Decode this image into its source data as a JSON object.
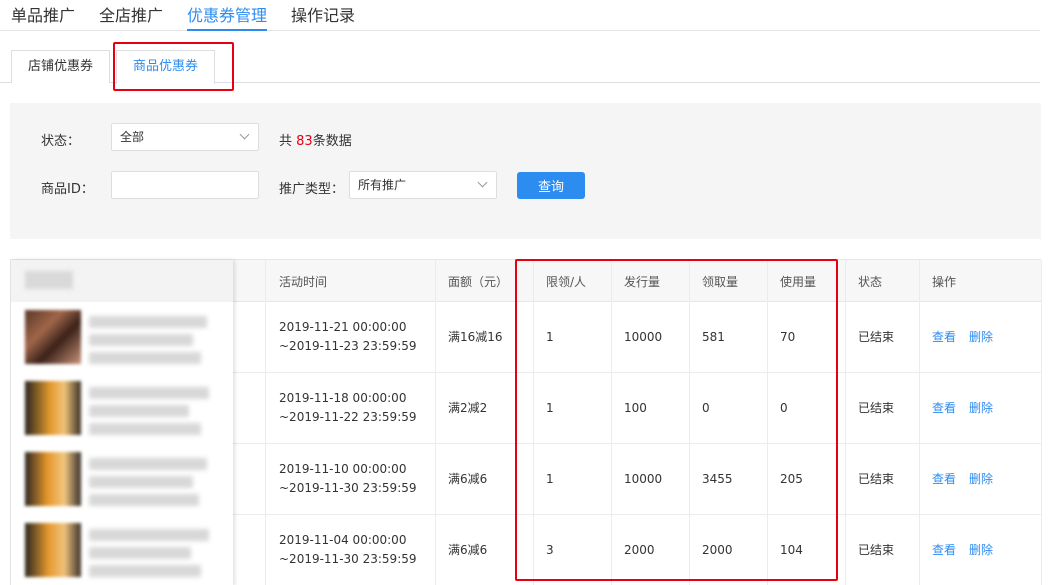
{
  "top_tabs": [
    "单品推广",
    "全店推广",
    "优惠券管理",
    "操作记录"
  ],
  "sub_tabs": [
    "店铺优惠券",
    "商品优惠券"
  ],
  "filter": {
    "status_label": "状态：",
    "status_value": "全部",
    "count_prefix": "共",
    "count_value": "83",
    "count_suffix": "条数据",
    "product_id_label": "商品ID：",
    "product_id_value": "",
    "promo_type_label": "推广类型：",
    "promo_type_value": "所有推广",
    "query_button": "查询"
  },
  "table": {
    "columns": [
      "活动时间",
      "面额（元）",
      "限领/人",
      "发行量",
      "领取量",
      "使用量",
      "状态",
      "操作"
    ],
    "actions": {
      "view": "查看",
      "delete": "删除"
    },
    "rows": [
      {
        "start": "2019-11-21 00:00:00",
        "end": "~2019-11-23 23:59:59",
        "denomination": "满16减16",
        "limit": "1",
        "issued": "10000",
        "claimed": "581",
        "used": "70",
        "status": "已结束"
      },
      {
        "start": "2019-11-18 00:00:00",
        "end": "~2019-11-22 23:59:59",
        "denomination": "满2减2",
        "limit": "1",
        "issued": "100",
        "claimed": "0",
        "used": "0",
        "status": "已结束"
      },
      {
        "start": "2019-11-10 00:00:00",
        "end": "~2019-11-30 23:59:59",
        "denomination": "满6减6",
        "limit": "1",
        "issued": "10000",
        "claimed": "3455",
        "used": "205",
        "status": "已结束"
      },
      {
        "start": "2019-11-04 00:00:00",
        "end": "~2019-11-30 23:59:59",
        "denomination": "满6减6",
        "limit": "3",
        "issued": "2000",
        "claimed": "2000",
        "used": "104",
        "status": "已结束"
      }
    ]
  },
  "colors": {
    "accent": "#2d8cf0",
    "highlight": "#e60012",
    "count": "#e60012"
  }
}
